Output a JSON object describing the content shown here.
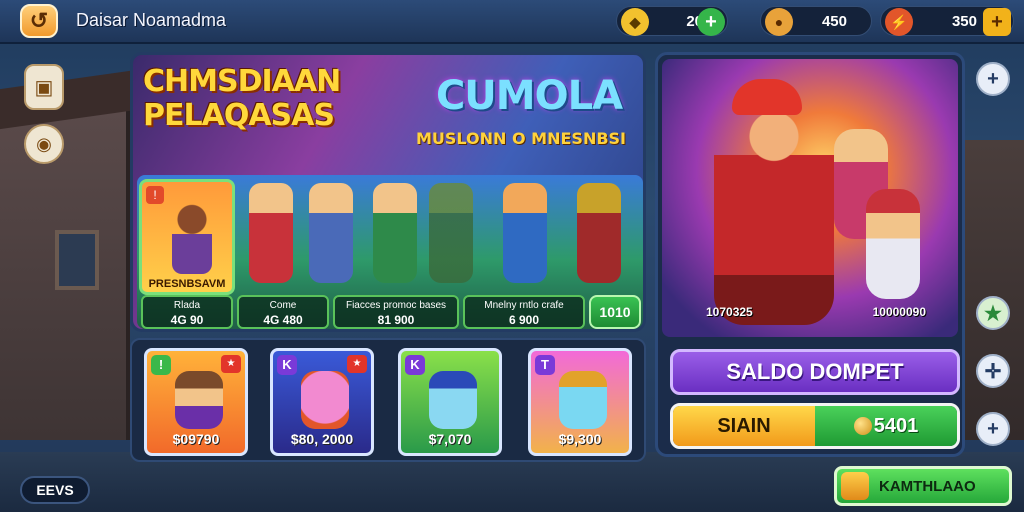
{
  "header": {
    "app_title": "Daisar Noamadma",
    "currencies": [
      {
        "icon": "gem-icon",
        "value": "20",
        "plus": "+"
      },
      {
        "icon": "coin-icon",
        "value": "450",
        "plus": ""
      },
      {
        "icon": "energy-icon",
        "value": "350",
        "plus": "+"
      }
    ]
  },
  "promo": {
    "title_line1": "CHMSDIAAN",
    "title_line2": "PELAQASAS",
    "logo": "CUMOLA",
    "subtitle": "MUSLONN O MNESNBSI",
    "featured_label": "PRESNBSAVM",
    "stats": [
      {
        "label": "Rlada",
        "value": "4G 90"
      },
      {
        "label": "Come",
        "value": "4G 480"
      },
      {
        "label": "Fiacces promoc bases",
        "value": "81 900"
      },
      {
        "label": "Mnelny rntlo crafe",
        "value": "6 900"
      }
    ],
    "total": "1010"
  },
  "cards": [
    {
      "tag": "!",
      "price": "$09790"
    },
    {
      "tag": "K",
      "price": "$80, 2000"
    },
    {
      "tag": "K",
      "price": "$7,070"
    },
    {
      "tag": "T",
      "price": "$9,300"
    }
  ],
  "right_panel": {
    "hero_stat_left": "1070325",
    "hero_stat_right": "10000090",
    "saldo_label": "SALDO DOMPET",
    "split_left": "SIAIN",
    "split_right": "5401"
  },
  "bottom": {
    "left_button": "EEVS",
    "right_button": "KAMTHLAAO"
  },
  "colors": {
    "accent_gold": "#ffd83b",
    "purple_button": "#7a3ed6",
    "green_button": "#2eb844"
  }
}
